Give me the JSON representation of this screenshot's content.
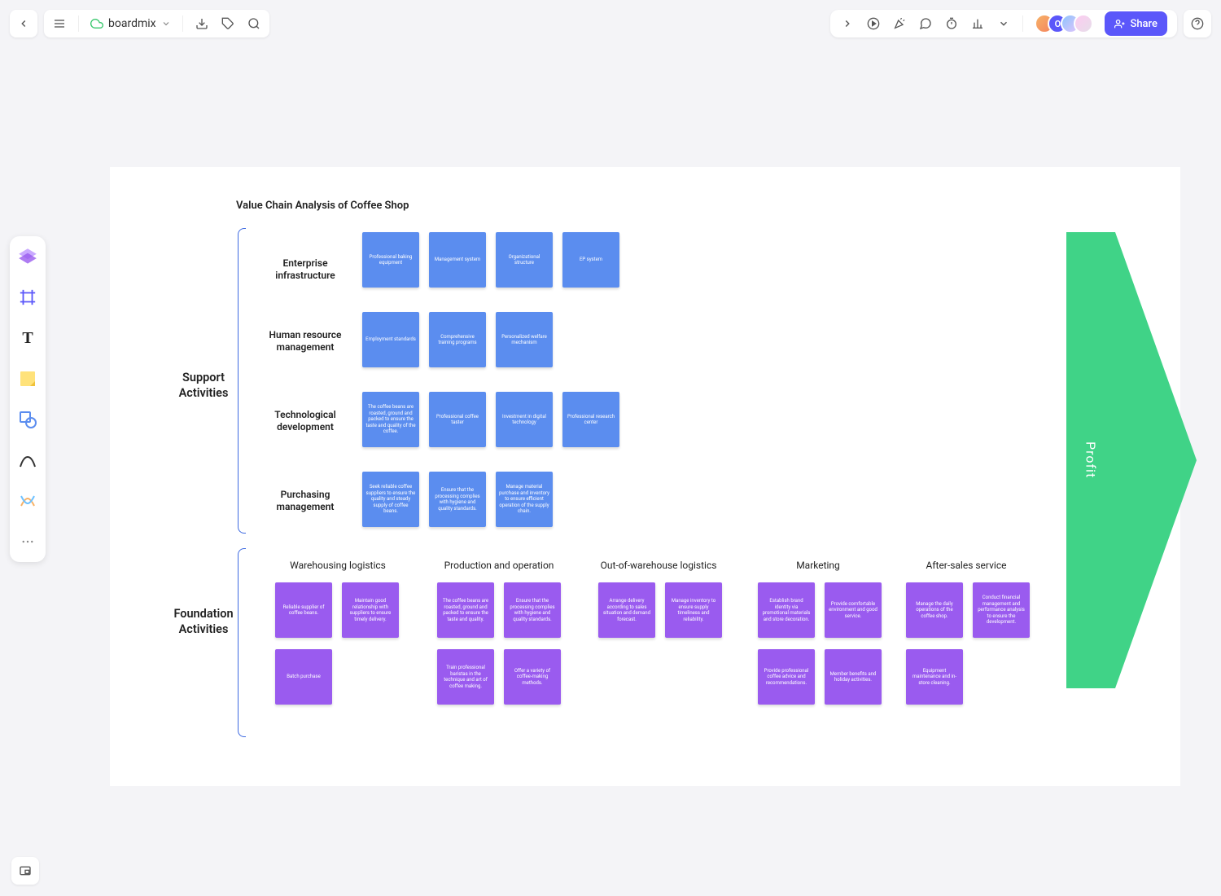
{
  "header": {
    "brand": "boardmix",
    "share_label": "Share"
  },
  "diagram": {
    "title": "Value Chain Analysis of Coffee Shop",
    "sections": {
      "support": "Support\nActivities",
      "foundation": "Foundation\nActivities"
    },
    "support_rows": {
      "r1": {
        "label": "Enterprise infrastructure",
        "cards": [
          "Professional baking equipment",
          "Management system",
          "Organizational structure",
          "EP system"
        ]
      },
      "r2": {
        "label": "Human resource management",
        "cards": [
          "Employment standards",
          "Comprehensive training programs",
          "Personalized welfare mechanism"
        ]
      },
      "r3": {
        "label": "Technological development",
        "cards": [
          "The coffee beans are roasted, ground and packed to ensure the taste and quality of the coffee.",
          "Professional coffee taster",
          "Investment in digital technology",
          "Professional research center"
        ]
      },
      "r4": {
        "label": "Purchasing management",
        "cards": [
          "Seek reliable coffee suppliers to ensure the quality and steady supply of coffee beans.",
          "Ensure that the processing complies with hygiene and quality standards.",
          "Manage material purchase and inventory to ensure efficient operation of the supply chain."
        ]
      }
    },
    "foundation_cols": {
      "c1": {
        "head": "Warehousing logistics",
        "cards": [
          [
            "Reliable supplier of coffee beans.",
            "Maintain good relationship with suppliers to ensure timely delivery."
          ],
          [
            "Batch purchase"
          ]
        ]
      },
      "c2": {
        "head": "Production and operation",
        "cards": [
          [
            "The coffee beans are roasted, ground and packed to ensure the taste and quality.",
            "Ensure that the processing complies with hygiene and quality standards."
          ],
          [
            "Train professional baristas in the technique and art of coffee making.",
            "Offer a variety of coffee-making methods."
          ]
        ]
      },
      "c3": {
        "head": "Out-of-warehouse logistics",
        "cards": [
          [
            "Arrange delivery according to sales situation and demand forecast.",
            "Manage inventory to ensure supply timeliness and reliability."
          ]
        ]
      },
      "c4": {
        "head": "Marketing",
        "cards": [
          [
            "Establish brand identity via promotional materials and store decoration.",
            "Provide comfortable environment and good service."
          ],
          [
            "Provide professional coffee advice and recommendations.",
            "Member benefits and holiday activities."
          ]
        ]
      },
      "c5": {
        "head": "After-sales service",
        "cards": [
          [
            "Manage the daily operations of the coffee shop.",
            "Conduct financial management and performance analysis to ensure the development."
          ],
          [
            "Equipment maintenance and in-store cleaning."
          ]
        ]
      }
    },
    "arrow_label": "Profit"
  }
}
